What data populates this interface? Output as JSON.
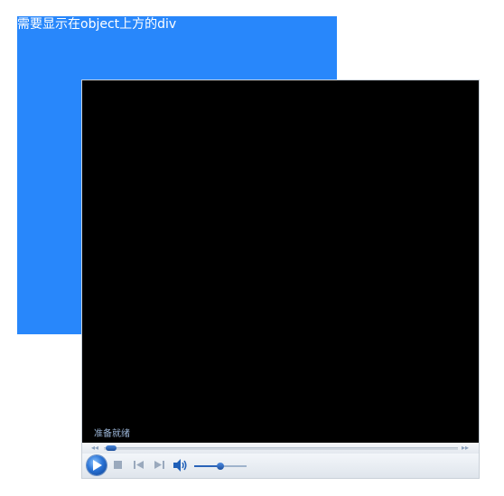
{
  "overlay": {
    "text": "需要显示在object上方的div",
    "color": "#2887fb"
  },
  "player": {
    "status": "准备就绪",
    "icons": {
      "rewind": "rewind-icon",
      "fast_forward": "fast-forward-icon",
      "play": "play-icon",
      "stop": "stop-icon",
      "previous": "previous-track-icon",
      "next": "next-track-icon",
      "volume": "volume-icon"
    },
    "seek_position_fraction": 0.0,
    "volume_fraction": 0.5
  }
}
